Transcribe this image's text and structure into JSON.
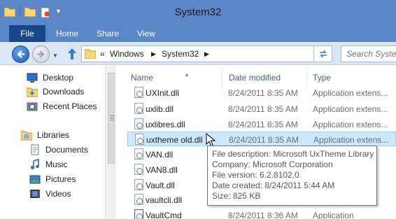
{
  "window": {
    "title": "System32"
  },
  "ribbon": {
    "tabs": [
      "File",
      "Home",
      "Share",
      "View"
    ]
  },
  "address": {
    "overflow": "«",
    "crumbs": [
      "Windows",
      "System32"
    ],
    "search_placeholder": "Search System32"
  },
  "nav_pane": {
    "favorites": [
      "Desktop",
      "Downloads",
      "Recent Places"
    ],
    "libraries_label": "Libraries",
    "libraries": [
      "Documents",
      "Music",
      "Pictures",
      "Videos"
    ]
  },
  "columns": {
    "name": "Name",
    "date": "Date modified",
    "type": "Type"
  },
  "files": [
    {
      "name": "UXInit.dll",
      "date": "8/24/2011 8:35 AM",
      "type": "Application extens..."
    },
    {
      "name": "uxlib.dll",
      "date": "8/24/2011 8:35 AM",
      "type": "Application extens..."
    },
    {
      "name": "uxlibres.dll",
      "date": "8/24/2011 8:35 AM",
      "type": "Application extens..."
    },
    {
      "name": "uxtheme old.dll",
      "date": "8/24/2011 8:35 AM",
      "type": "Application extens..."
    },
    {
      "name": "VAN.dll",
      "date": "",
      "type": ""
    },
    {
      "name": "VAN8.dll",
      "date": "",
      "type": ""
    },
    {
      "name": "Vault.dll",
      "date": "",
      "type": ""
    },
    {
      "name": "vaultcli.dll",
      "date": "",
      "type": ""
    },
    {
      "name": "VaultCmd",
      "date": "8/24/2011 8:36 AM",
      "type": "Application"
    }
  ],
  "tooltip": {
    "description": "File description: Microsoft UxTheme Library",
    "company": "Company: Microsoft Corporation",
    "version": "File version: 6.2.8102.0",
    "created": "Date created: 8/24/2011 5:44 AM",
    "size": "Size: 825 KB"
  },
  "colors": {
    "titlebar": "#5b86c8",
    "file_tab": "#19478a",
    "selection": "#cce8ff",
    "selection_border": "#99d1ff"
  }
}
